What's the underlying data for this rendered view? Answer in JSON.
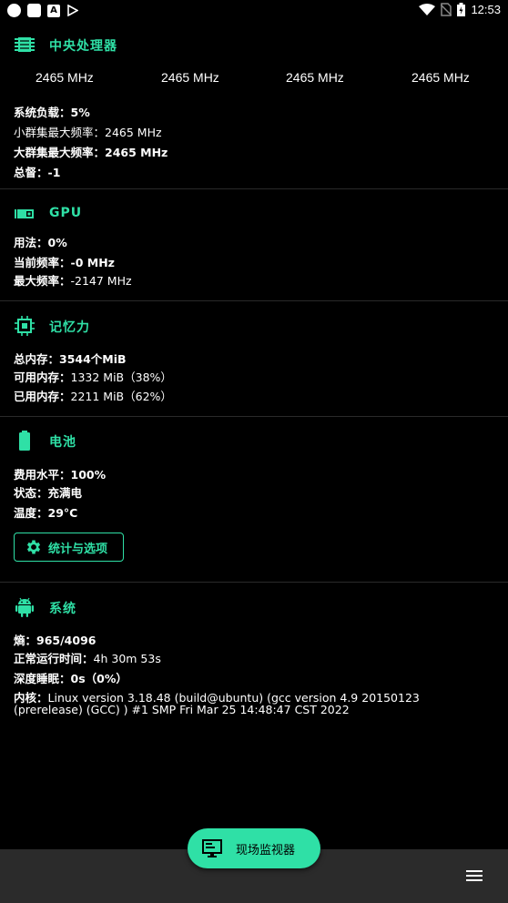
{
  "status_bar": {
    "time": "12:53",
    "notif_letter": "A"
  },
  "cpu": {
    "title": "中央处理器",
    "freqs": [
      "2465 MHz",
      "2465 MHz",
      "2465 MHz",
      "2465 MHz"
    ],
    "load_label": "系统负载：",
    "load_value": "5%",
    "little_label": "小群集最大频率：",
    "little_value": "2465 MHz",
    "big_label": "大群集最大频率：",
    "big_value": "2465 MHz",
    "governor_label": "总督：",
    "governor_value": "-1"
  },
  "gpu": {
    "title": "GPU",
    "usage_label": "用法：",
    "usage_value": "0%",
    "cur_label": "当前频率：",
    "cur_value": "-0 MHz",
    "max_label": "最大频率：",
    "max_value": "-2147 MHz"
  },
  "memory": {
    "title": "记忆力",
    "total_label": "总内存：",
    "total_value": "3544个MiB",
    "avail_label": "可用内存：",
    "avail_value": "1332 MiB（38%）",
    "used_label": "已用内存：",
    "used_value": "2211 MiB（62%）"
  },
  "battery": {
    "title": "电池",
    "level_label": "费用水平：",
    "level_value": "100%",
    "status_label": "状态：",
    "status_value": "充满电",
    "temp_label": "温度：",
    "temp_value": "29°C",
    "stats_button": "统计与选项"
  },
  "system": {
    "title": "系统",
    "entropy_label": "熵：",
    "entropy_value": "965/4096",
    "uptime_label": "正常运行时间：",
    "uptime_value": "4h 30m 53s",
    "sleep_label": "深度睡眠：",
    "sleep_value": "0s（0%）",
    "kernel_label": "内核：",
    "kernel_line1": "Linux version 3.18.48 (build@ubuntu) (gcc version 4.9 20150123",
    "kernel_line2": "(prerelease) (GCC) ) #1 SMP Fri Mar 25 14:48:47 CST 2022"
  },
  "fab": {
    "label": "现场监视器"
  },
  "colors": {
    "accent": "#2fe0a6",
    "background": "#000000",
    "bottom_bar": "#2b2b2b"
  }
}
